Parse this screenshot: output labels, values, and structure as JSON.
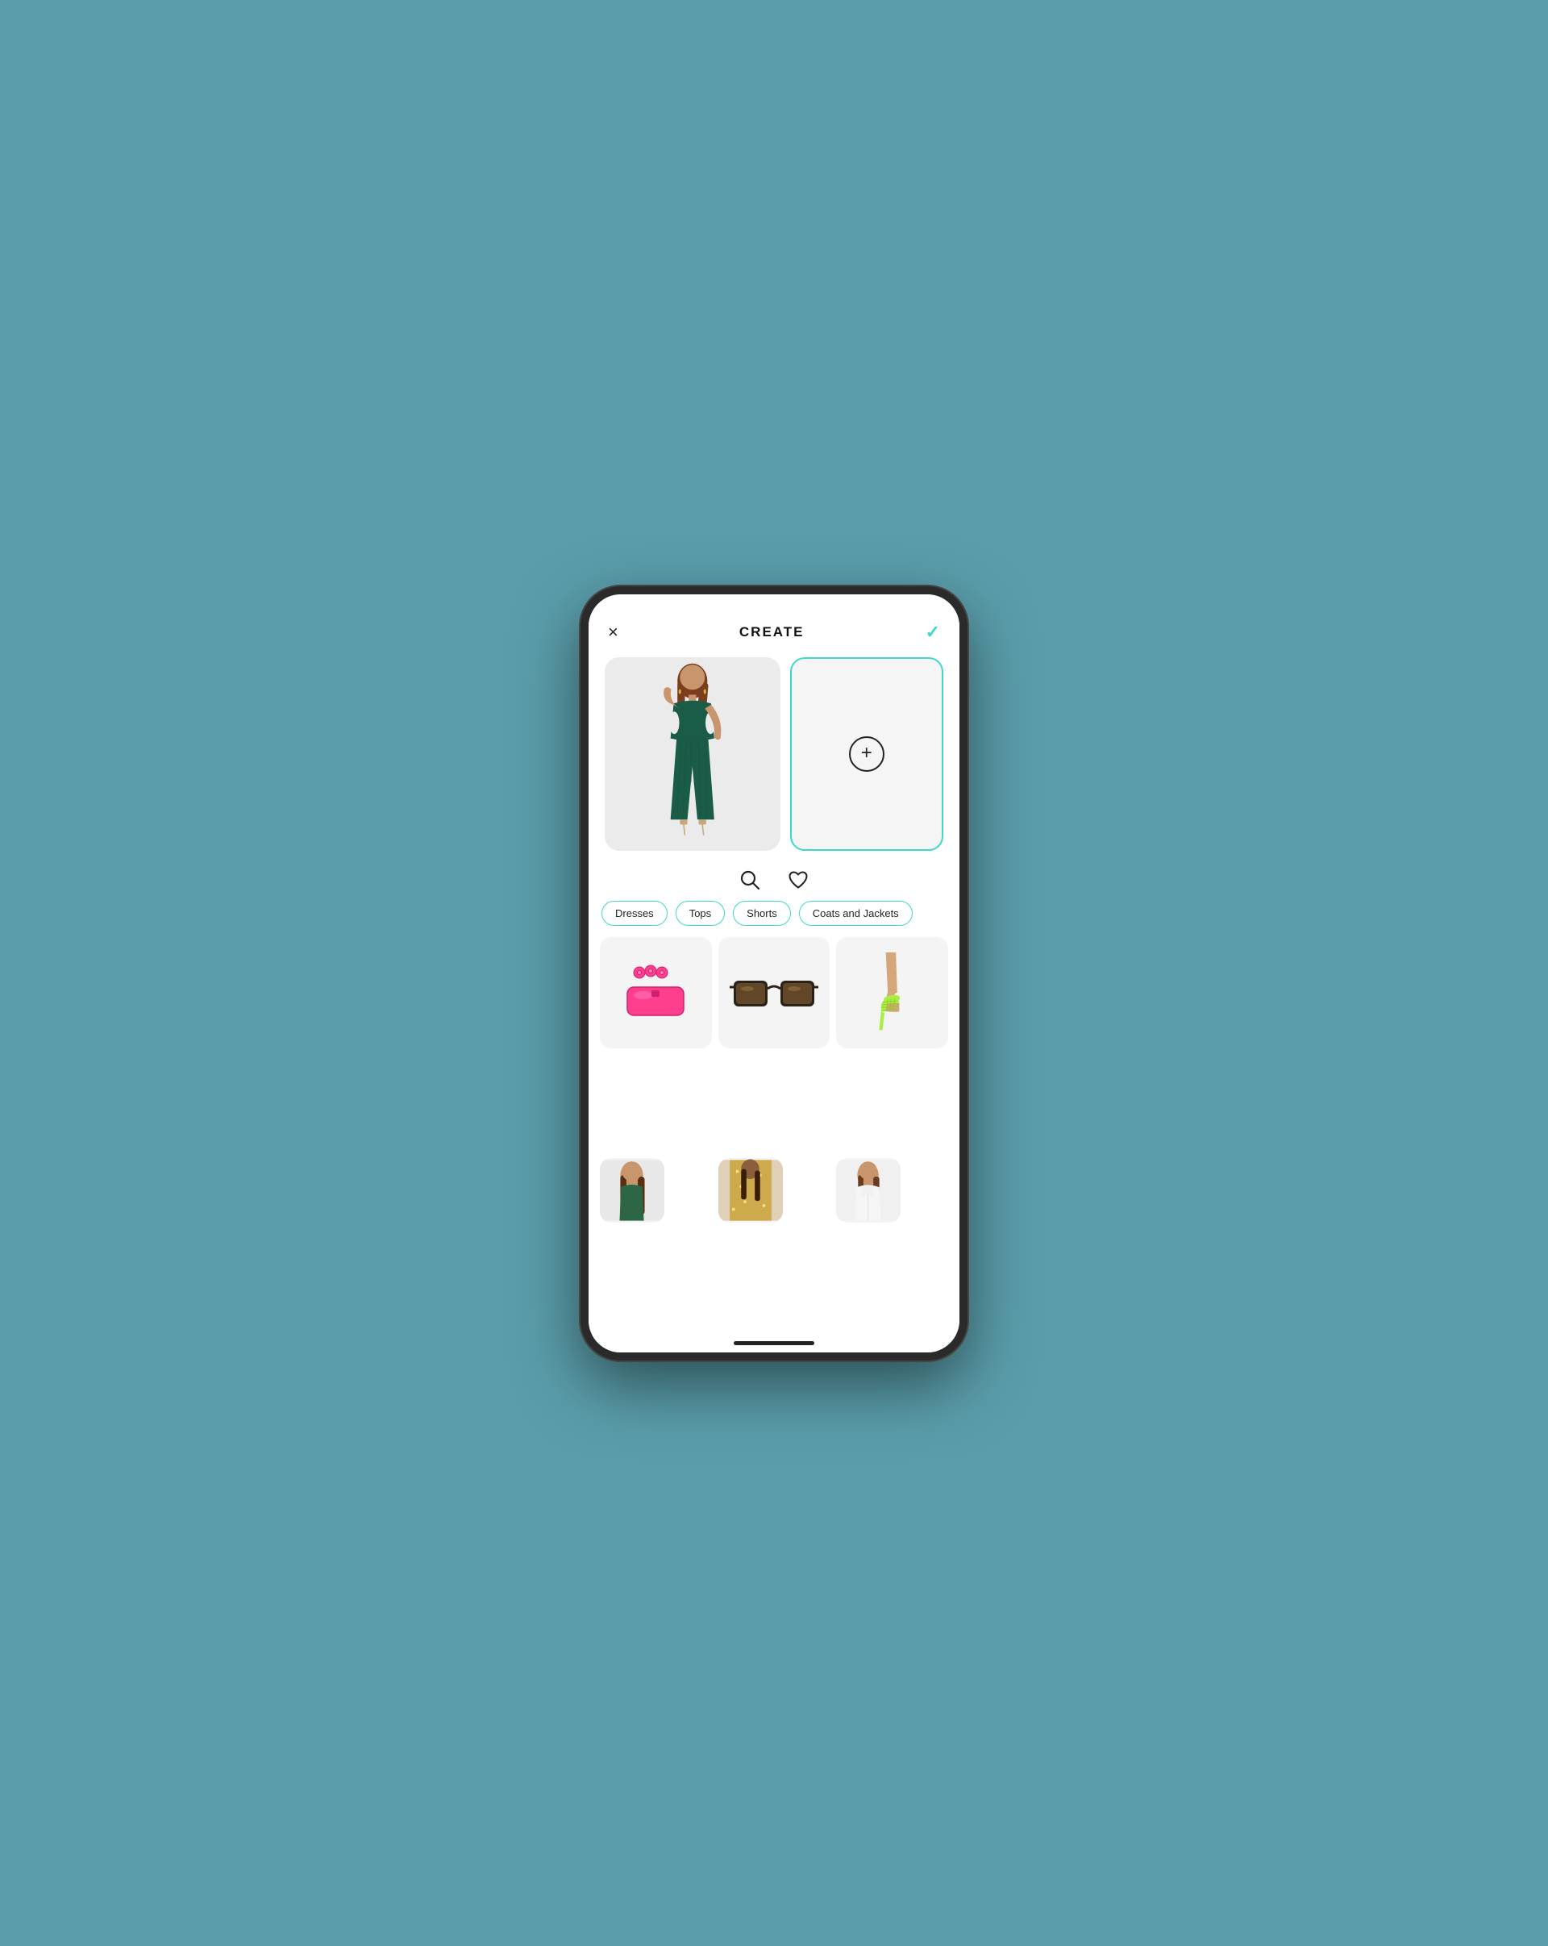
{
  "header": {
    "title": "CREATE",
    "close_label": "×",
    "check_icon": "✓"
  },
  "image_slot": {
    "add_placeholder": "+"
  },
  "action_icons": {
    "search_label": "search",
    "heart_label": "heart/favorites"
  },
  "filter_pills": [
    {
      "label": "Dresses",
      "active": false
    },
    {
      "label": "Tops",
      "active": false
    },
    {
      "label": "Shorts",
      "active": false
    },
    {
      "label": "Coats and Jackets",
      "active": false
    }
  ],
  "products": [
    {
      "name": "Pink Clutch Bag",
      "type": "accessory"
    },
    {
      "name": "Square Sunglasses",
      "type": "accessory"
    },
    {
      "name": "Green Heeled Mules",
      "type": "footwear"
    },
    {
      "name": "Green Outfit Model",
      "type": "outfit"
    },
    {
      "name": "Sequin Outfit",
      "type": "outfit"
    },
    {
      "name": "White Outfit Model",
      "type": "outfit"
    }
  ],
  "colors": {
    "accent": "#3DD9C5",
    "background": "#5a9eab",
    "text": "#111111"
  }
}
